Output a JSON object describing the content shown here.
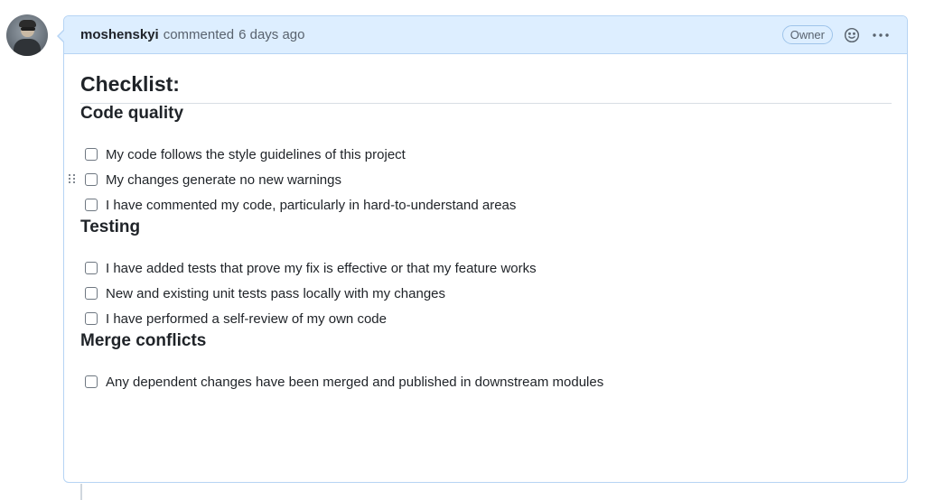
{
  "comment": {
    "author": "moshenskyi",
    "action": "commented",
    "time": "6 days ago",
    "badge": "Owner",
    "icons": {
      "reaction": "smiley-icon",
      "more": "kebab-horizontal-icon",
      "drag": "grabber-icon"
    }
  },
  "body": {
    "title": "Checklist:",
    "sections": [
      {
        "heading": "Code quality",
        "items": [
          {
            "label": "My code follows the style guidelines of this project",
            "checked": false
          },
          {
            "label": "My changes generate no new warnings",
            "checked": false
          },
          {
            "label": "I have commented my code, particularly in hard-to-understand areas",
            "checked": false
          }
        ]
      },
      {
        "heading": "Testing",
        "items": [
          {
            "label": "I have added tests that prove my fix is effective or that my feature works",
            "checked": false
          },
          {
            "label": "New and existing unit tests pass locally with my changes",
            "checked": false
          },
          {
            "label": "I have performed a self-review of my own code",
            "checked": false
          }
        ]
      },
      {
        "heading": "Merge conflicts",
        "items": [
          {
            "label": "Any dependent changes have been merged and published in downstream modules",
            "checked": false
          }
        ]
      }
    ]
  },
  "colors": {
    "header_bg": "#ddeeff",
    "border": "#b6d4f4",
    "text": "#1f2328",
    "muted": "#59636e"
  }
}
